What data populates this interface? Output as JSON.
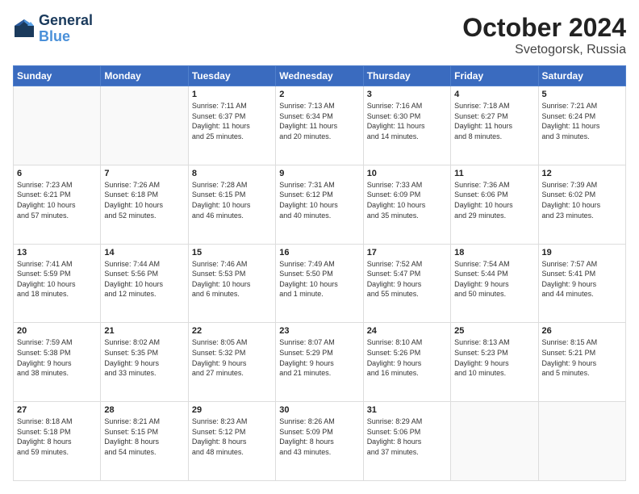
{
  "header": {
    "logo_line1": "General",
    "logo_line2": "Blue",
    "month": "October 2024",
    "location": "Svetogorsk, Russia"
  },
  "weekdays": [
    "Sunday",
    "Monday",
    "Tuesday",
    "Wednesday",
    "Thursday",
    "Friday",
    "Saturday"
  ],
  "weeks": [
    [
      {
        "day": "",
        "info": ""
      },
      {
        "day": "",
        "info": ""
      },
      {
        "day": "1",
        "info": "Sunrise: 7:11 AM\nSunset: 6:37 PM\nDaylight: 11 hours\nand 25 minutes."
      },
      {
        "day": "2",
        "info": "Sunrise: 7:13 AM\nSunset: 6:34 PM\nDaylight: 11 hours\nand 20 minutes."
      },
      {
        "day": "3",
        "info": "Sunrise: 7:16 AM\nSunset: 6:30 PM\nDaylight: 11 hours\nand 14 minutes."
      },
      {
        "day": "4",
        "info": "Sunrise: 7:18 AM\nSunset: 6:27 PM\nDaylight: 11 hours\nand 8 minutes."
      },
      {
        "day": "5",
        "info": "Sunrise: 7:21 AM\nSunset: 6:24 PM\nDaylight: 11 hours\nand 3 minutes."
      }
    ],
    [
      {
        "day": "6",
        "info": "Sunrise: 7:23 AM\nSunset: 6:21 PM\nDaylight: 10 hours\nand 57 minutes."
      },
      {
        "day": "7",
        "info": "Sunrise: 7:26 AM\nSunset: 6:18 PM\nDaylight: 10 hours\nand 52 minutes."
      },
      {
        "day": "8",
        "info": "Sunrise: 7:28 AM\nSunset: 6:15 PM\nDaylight: 10 hours\nand 46 minutes."
      },
      {
        "day": "9",
        "info": "Sunrise: 7:31 AM\nSunset: 6:12 PM\nDaylight: 10 hours\nand 40 minutes."
      },
      {
        "day": "10",
        "info": "Sunrise: 7:33 AM\nSunset: 6:09 PM\nDaylight: 10 hours\nand 35 minutes."
      },
      {
        "day": "11",
        "info": "Sunrise: 7:36 AM\nSunset: 6:06 PM\nDaylight: 10 hours\nand 29 minutes."
      },
      {
        "day": "12",
        "info": "Sunrise: 7:39 AM\nSunset: 6:02 PM\nDaylight: 10 hours\nand 23 minutes."
      }
    ],
    [
      {
        "day": "13",
        "info": "Sunrise: 7:41 AM\nSunset: 5:59 PM\nDaylight: 10 hours\nand 18 minutes."
      },
      {
        "day": "14",
        "info": "Sunrise: 7:44 AM\nSunset: 5:56 PM\nDaylight: 10 hours\nand 12 minutes."
      },
      {
        "day": "15",
        "info": "Sunrise: 7:46 AM\nSunset: 5:53 PM\nDaylight: 10 hours\nand 6 minutes."
      },
      {
        "day": "16",
        "info": "Sunrise: 7:49 AM\nSunset: 5:50 PM\nDaylight: 10 hours\nand 1 minute."
      },
      {
        "day": "17",
        "info": "Sunrise: 7:52 AM\nSunset: 5:47 PM\nDaylight: 9 hours\nand 55 minutes."
      },
      {
        "day": "18",
        "info": "Sunrise: 7:54 AM\nSunset: 5:44 PM\nDaylight: 9 hours\nand 50 minutes."
      },
      {
        "day": "19",
        "info": "Sunrise: 7:57 AM\nSunset: 5:41 PM\nDaylight: 9 hours\nand 44 minutes."
      }
    ],
    [
      {
        "day": "20",
        "info": "Sunrise: 7:59 AM\nSunset: 5:38 PM\nDaylight: 9 hours\nand 38 minutes."
      },
      {
        "day": "21",
        "info": "Sunrise: 8:02 AM\nSunset: 5:35 PM\nDaylight: 9 hours\nand 33 minutes."
      },
      {
        "day": "22",
        "info": "Sunrise: 8:05 AM\nSunset: 5:32 PM\nDaylight: 9 hours\nand 27 minutes."
      },
      {
        "day": "23",
        "info": "Sunrise: 8:07 AM\nSunset: 5:29 PM\nDaylight: 9 hours\nand 21 minutes."
      },
      {
        "day": "24",
        "info": "Sunrise: 8:10 AM\nSunset: 5:26 PM\nDaylight: 9 hours\nand 16 minutes."
      },
      {
        "day": "25",
        "info": "Sunrise: 8:13 AM\nSunset: 5:23 PM\nDaylight: 9 hours\nand 10 minutes."
      },
      {
        "day": "26",
        "info": "Sunrise: 8:15 AM\nSunset: 5:21 PM\nDaylight: 9 hours\nand 5 minutes."
      }
    ],
    [
      {
        "day": "27",
        "info": "Sunrise: 8:18 AM\nSunset: 5:18 PM\nDaylight: 8 hours\nand 59 minutes."
      },
      {
        "day": "28",
        "info": "Sunrise: 8:21 AM\nSunset: 5:15 PM\nDaylight: 8 hours\nand 54 minutes."
      },
      {
        "day": "29",
        "info": "Sunrise: 8:23 AM\nSunset: 5:12 PM\nDaylight: 8 hours\nand 48 minutes."
      },
      {
        "day": "30",
        "info": "Sunrise: 8:26 AM\nSunset: 5:09 PM\nDaylight: 8 hours\nand 43 minutes."
      },
      {
        "day": "31",
        "info": "Sunrise: 8:29 AM\nSunset: 5:06 PM\nDaylight: 8 hours\nand 37 minutes."
      },
      {
        "day": "",
        "info": ""
      },
      {
        "day": "",
        "info": ""
      }
    ]
  ]
}
